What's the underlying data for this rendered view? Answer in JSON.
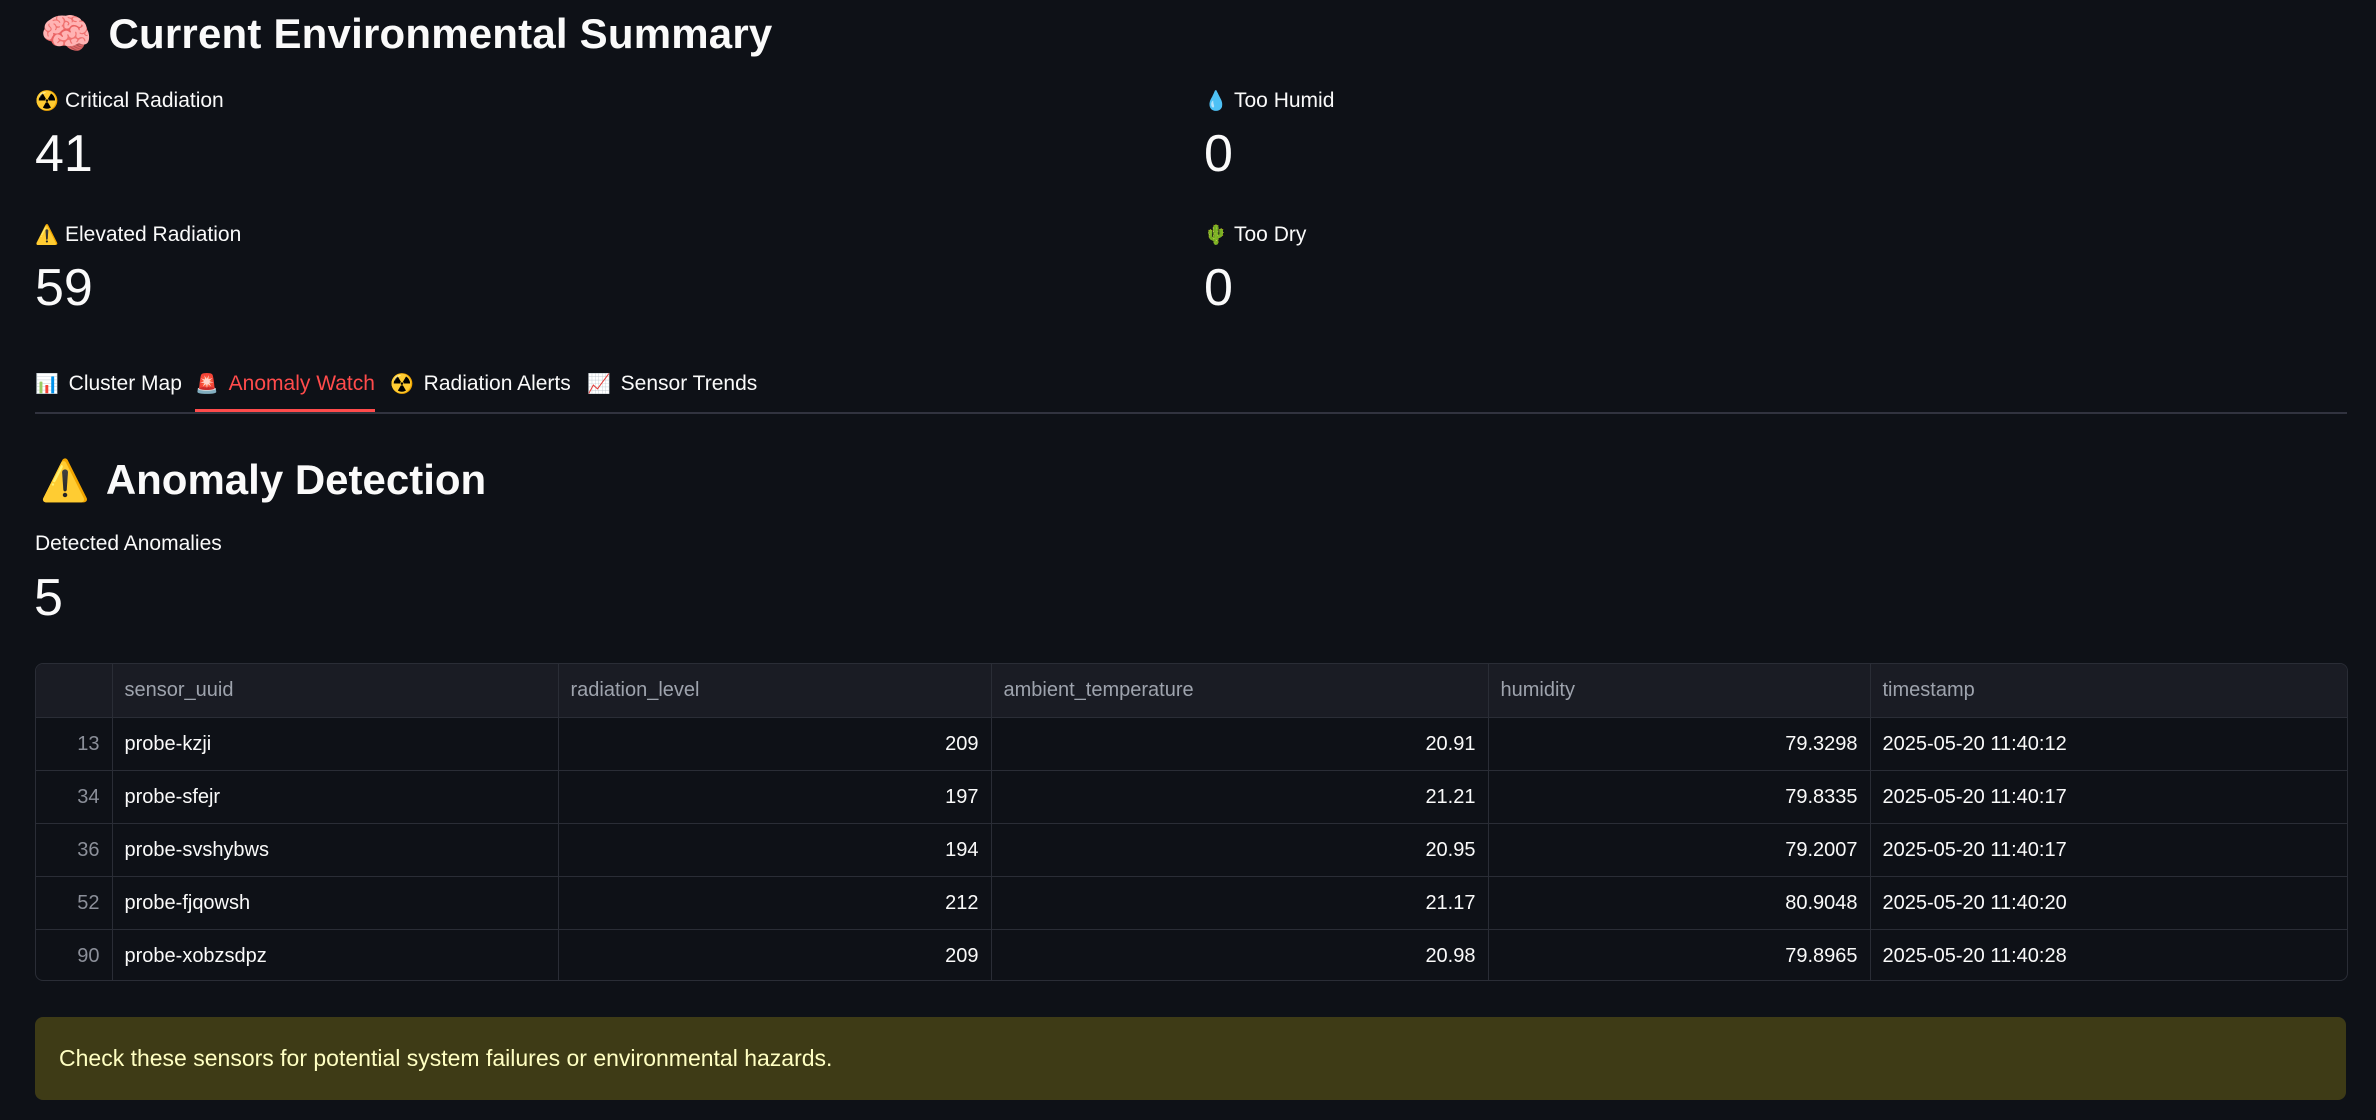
{
  "summary": {
    "title_icon": "🧠",
    "title": "Current Environmental Summary"
  },
  "metrics": [
    {
      "icon": "☢️",
      "icon_name": "radiation-icon",
      "label": "Critical Radiation",
      "value": "41"
    },
    {
      "icon": "💧",
      "icon_name": "droplet-icon",
      "label": "Too Humid",
      "value": "0"
    },
    {
      "icon": "⚠️",
      "icon_name": "warning-icon",
      "label": "Elevated Radiation",
      "value": "59"
    },
    {
      "icon": "🌵",
      "icon_name": "cactus-icon",
      "label": "Too Dry",
      "value": "0"
    }
  ],
  "tabs": [
    {
      "icon": "📊",
      "icon_name": "bar-chart-icon",
      "label": "Cluster Map",
      "active": false
    },
    {
      "icon": "🚨",
      "icon_name": "siren-icon",
      "label": "Anomaly Watch",
      "active": true
    },
    {
      "icon": "☢️",
      "icon_name": "radiation-icon",
      "label": "Radiation Alerts",
      "active": false
    },
    {
      "icon": "📈",
      "icon_name": "trend-chart-icon",
      "label": "Sensor Trends",
      "active": false
    }
  ],
  "section": {
    "title_icon": "⚠️",
    "title": "Anomaly Detection"
  },
  "anomalies": {
    "label": "Detected Anomalies",
    "value": "5"
  },
  "table": {
    "columns": [
      "",
      "sensor_uuid",
      "radiation_level",
      "ambient_temperature",
      "humidity",
      "timestamp"
    ],
    "rows": [
      [
        "13",
        "probe-kzji",
        "209",
        "20.91",
        "79.3298",
        "2025-05-20 11:40:12"
      ],
      [
        "34",
        "probe-sfejr",
        "197",
        "21.21",
        "79.8335",
        "2025-05-20 11:40:17"
      ],
      [
        "36",
        "probe-svshybws",
        "194",
        "20.95",
        "79.2007",
        "2025-05-20 11:40:17"
      ],
      [
        "52",
        "probe-fjqowsh",
        "212",
        "21.17",
        "80.9048",
        "2025-05-20 11:40:20"
      ],
      [
        "90",
        "probe-xobzsdpz",
        "209",
        "20.98",
        "79.8965",
        "2025-05-20 11:40:28"
      ]
    ]
  },
  "alert": {
    "text": "Check these sensors for potential system failures or environmental hazards."
  },
  "colors": {
    "background": "#0e1117",
    "accent": "#ff4b4b",
    "warning_bg": "#3e3b16",
    "warning_text": "#ffffc2"
  }
}
